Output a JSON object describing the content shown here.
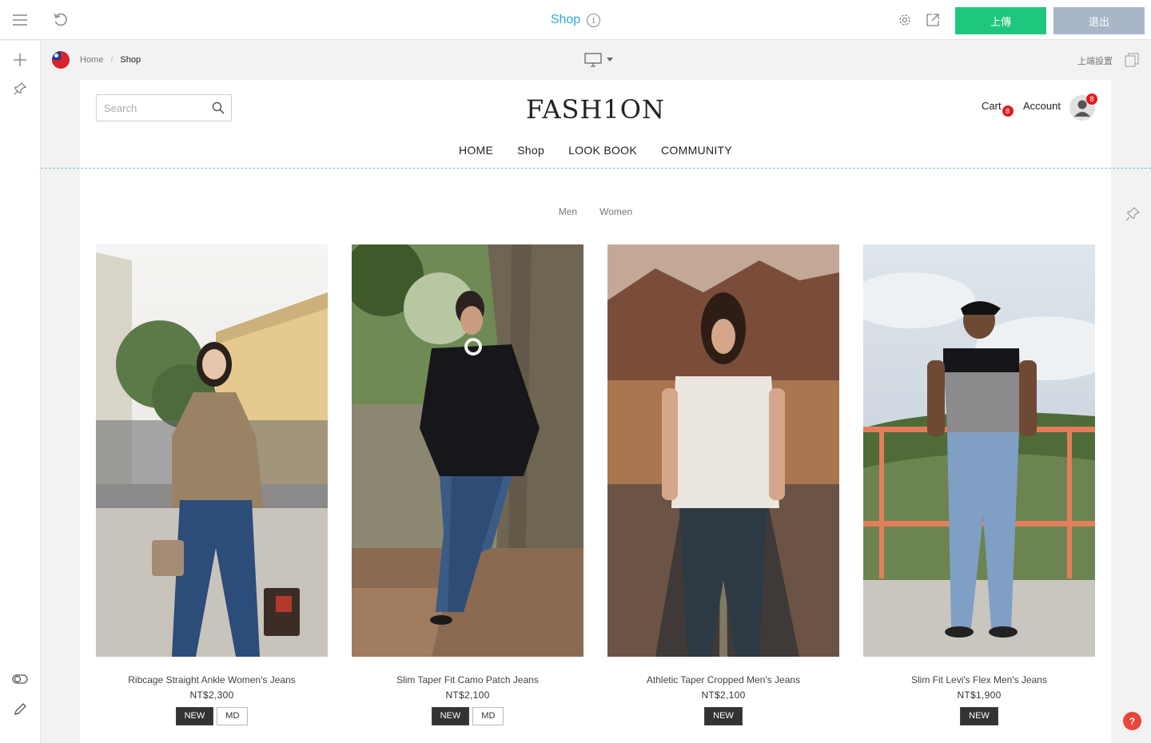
{
  "topbar": {
    "title": "Shop",
    "info_glyph": "i",
    "upload_label": "上傳",
    "exit_label": "退出",
    "icons": [
      "menu-icon",
      "undo-icon",
      "info-icon",
      "gear-icon",
      "external-link-icon"
    ]
  },
  "subbar": {
    "language_flag": "taiwan-flag-icon",
    "breadcrumb": [
      {
        "label": "Home"
      },
      {
        "separator": "/"
      },
      {
        "label": "Shop"
      }
    ],
    "device_icon": "desktop-icon",
    "top_settings_label": "上端設置",
    "duplicate_icon": "duplicate-icon"
  },
  "left_rail": {
    "icons": [
      "plus-icon",
      "pin-icon",
      "toggle-icon",
      "pencil-icon"
    ]
  },
  "site": {
    "search_placeholder": "Search",
    "logo": "FASH1ON",
    "cart_label": "Cart",
    "cart_count": "8",
    "account_label": "Account",
    "account_badge": "8",
    "nav": [
      "HOME",
      "Shop",
      "LOOK BOOK",
      "COMMUNITY"
    ],
    "filters": [
      "Men",
      "Women"
    ]
  },
  "products": [
    {
      "name": "Ribcage Straight Ankle Women's Jeans",
      "price": "NT$2,300",
      "tags": [
        "NEW",
        "MD"
      ],
      "photo": "woman-street-photo"
    },
    {
      "name": "Slim Taper Fit Camo Patch Jeans",
      "price": "NT$2,100",
      "tags": [
        "NEW",
        "MD"
      ],
      "photo": "man-tree-photo"
    },
    {
      "name": "Athletic Taper Cropped Men's Jeans",
      "price": "NT$2,100",
      "tags": [
        "NEW"
      ],
      "photo": "man-road-photo"
    },
    {
      "name": "Slim Fit Levi's Flex Men's Jeans",
      "price": "NT$1,900",
      "tags": [
        "NEW"
      ],
      "photo": "man-railing-photo"
    }
  ],
  "help_label": "?",
  "colors": {
    "accent": "#2aa8e0",
    "upload_button": "#1fc77e",
    "exit_button": "#a9b6c8",
    "badge": "#e31c1c",
    "help": "#e8463a"
  }
}
